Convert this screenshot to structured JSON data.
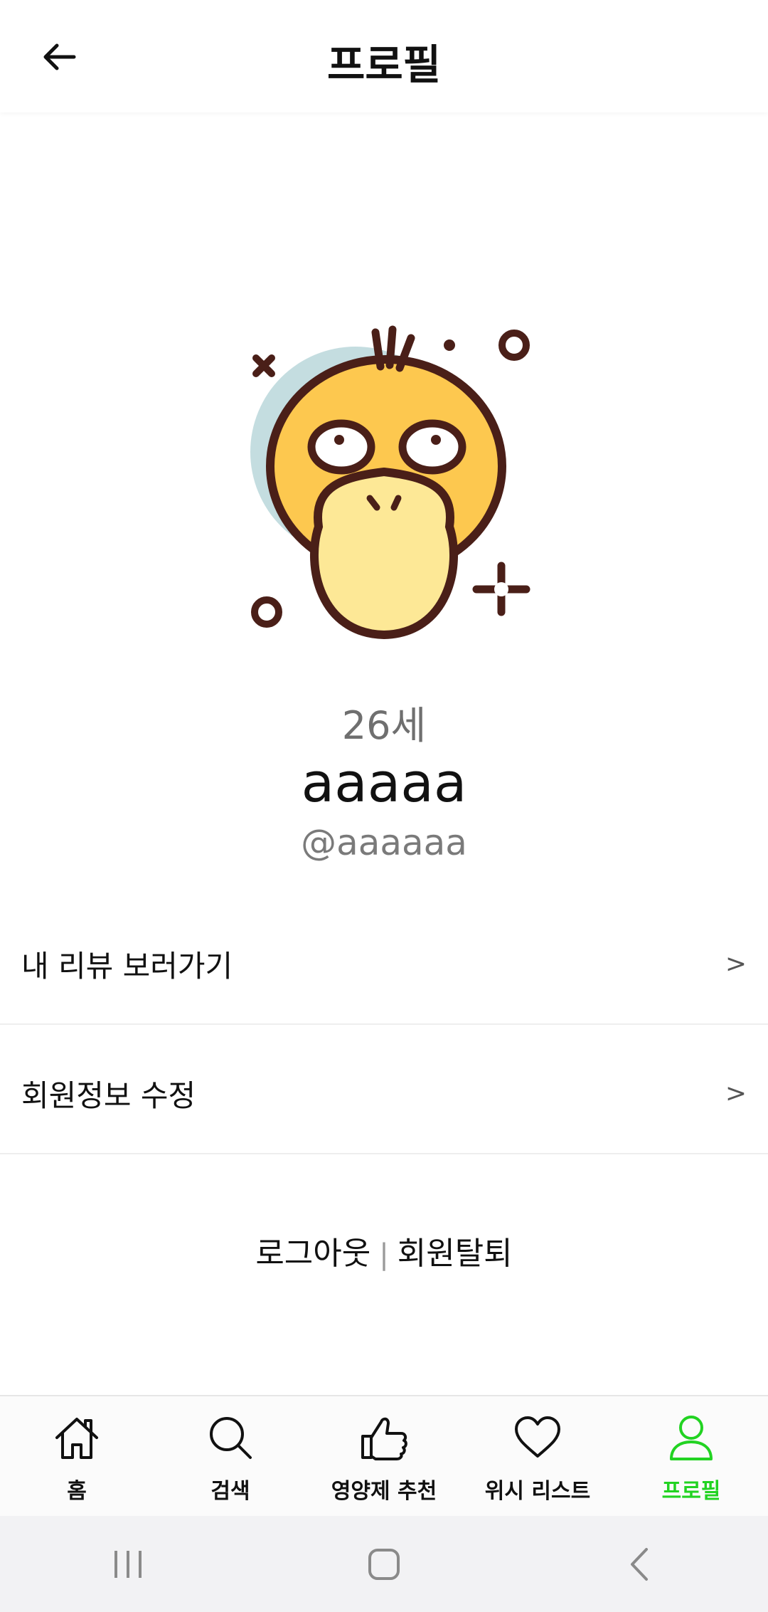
{
  "header": {
    "title": "프로필",
    "back_icon": "arrow-left-icon"
  },
  "profile": {
    "avatar_icon": "duck-avatar-icon",
    "age": "26세",
    "name": "aaaaa",
    "handle": "@aaaaaa"
  },
  "menu": [
    {
      "label": "내 리뷰 보러가기",
      "chevron": ">"
    },
    {
      "label": "회원정보 수정",
      "chevron": ">"
    }
  ],
  "auth": {
    "logout": "로그아웃",
    "separator": "|",
    "withdraw": "회원탈퇴"
  },
  "tabs": [
    {
      "label": "홈",
      "icon": "home-icon",
      "active": false
    },
    {
      "label": "검색",
      "icon": "search-icon",
      "active": false
    },
    {
      "label": "영양제 추천",
      "icon": "thumbs-up-icon",
      "active": false
    },
    {
      "label": "위시 리스트",
      "icon": "heart-icon",
      "active": false
    },
    {
      "label": "프로필",
      "icon": "person-icon",
      "active": true
    }
  ],
  "colors": {
    "accent": "#22d322",
    "avatar_bg": "#c4dde0",
    "duck_face": "#fdc84f",
    "duck_beak": "#fde896",
    "outline": "#4a1f18"
  },
  "system_nav": [
    "recent-apps-icon",
    "home-circle-icon",
    "back-chevron-icon"
  ]
}
